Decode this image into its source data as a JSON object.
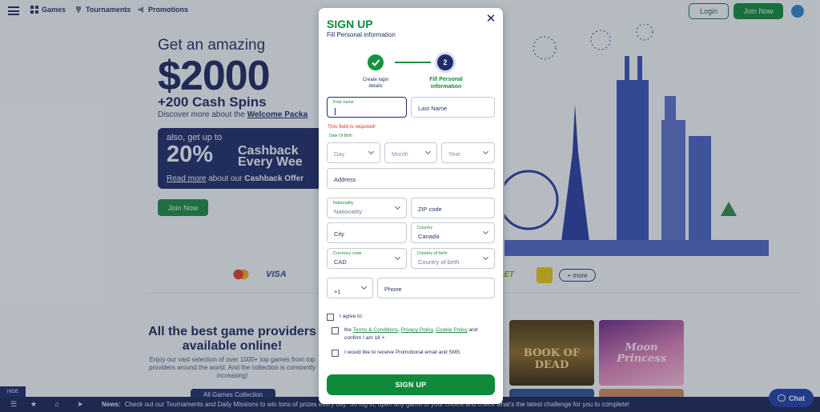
{
  "topbar": {
    "nav": [
      {
        "label": "Games",
        "icon": "games-icon"
      },
      {
        "label": "Tournaments",
        "icon": "trophy-icon"
      },
      {
        "label": "Promotions",
        "icon": "megaphone-icon"
      }
    ],
    "login_label": "Login",
    "join_label": "Join Now"
  },
  "hero": {
    "subtitle": "Get an amazing",
    "amount": "$2000",
    "spins": "+200 Cash Spins",
    "discover_prefix": "Discover more about the ",
    "discover_link": "Welcome Packa",
    "cashback_also": "also, get up to",
    "cashback_pct": "20%",
    "cashback_word1": "Cashback",
    "cashback_word2": "Every Wee",
    "read_more": "Read more",
    "read_more_suffix": " about our ",
    "cashback_offer": "Cashback Offer",
    "join_now": "Join Now"
  },
  "payments": {
    "visa": "VISA",
    "wallet": "LLET",
    "more": "+ more"
  },
  "providers": {
    "title": "All the best game providers available online!",
    "text": "Enjoy our vast selection of over 1000+ top games from top providers around the world. And the collection is constantly increasing!",
    "all_games": "All Games Collection",
    "tile1": "BOOK OF DEAD",
    "tile2": "Moon Princess"
  },
  "bottombar": {
    "hide": "HIDE",
    "news_label": "News:",
    "news_text": "Check out our Tournaments and Daily Missions to win tons of prizes every day. So log in, open any game of your choice and check what's the latest challenge for you to complete!",
    "chat": "Chat"
  },
  "modal": {
    "title": "SIGN UP",
    "subtitle": "Fill Personal information",
    "steps": [
      {
        "label": "Create login details",
        "state": "done"
      },
      {
        "number": "2",
        "label": "Fill Personal information",
        "state": "active"
      }
    ],
    "fields": {
      "first_name_label": "First name",
      "first_name_error": "This field is required!",
      "last_name": "Last Name",
      "dob_label": "Date Of Birth",
      "day": "Day",
      "month": "Month",
      "year": "Year",
      "address": "Address",
      "nationality_label": "Nationality",
      "nationality_value": "Nationality",
      "zip": "ZIP code",
      "city": "City",
      "country_label": "Country",
      "country_value": "Canada",
      "currency_label": "Currency code",
      "currency_value": "CAD",
      "birth_country_label": "Country of birth",
      "birth_country_value": "Country of birth",
      "phone_code": "+1",
      "phone": "Phone"
    },
    "agree_label": "I agree to:",
    "terms_prefix": "the ",
    "terms_link": "Terms & Conditions",
    "privacy_link": "Privacy Policy",
    "cookie_link": "Cookie Policy",
    "terms_suffix": " and confirm I am 18 +.",
    "promo_label": "I would like to receive Promotional email and SMS",
    "submit": "SIGN UP"
  },
  "colors": {
    "brand_green": "#0f8a3a",
    "navy": "#1f2d6a",
    "error_red": "#d6341c"
  }
}
